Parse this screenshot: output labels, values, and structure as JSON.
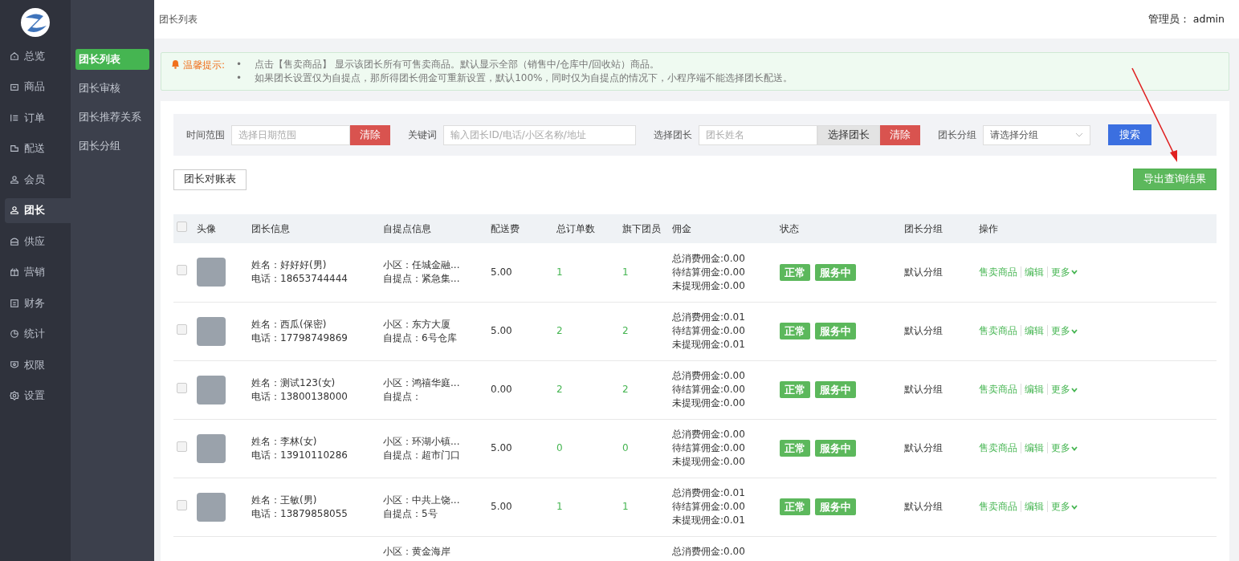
{
  "nav": [
    {
      "label": "总览",
      "selected": false
    },
    {
      "label": "商品",
      "selected": false
    },
    {
      "label": "订单",
      "selected": false
    },
    {
      "label": "配送",
      "selected": false
    },
    {
      "label": "会员",
      "selected": false
    },
    {
      "label": "团长",
      "selected": true
    },
    {
      "label": "供应",
      "selected": false
    },
    {
      "label": "营销",
      "selected": false
    },
    {
      "label": "财务",
      "selected": false
    },
    {
      "label": "统计",
      "selected": false
    },
    {
      "label": "权限",
      "selected": false
    },
    {
      "label": "设置",
      "selected": false
    }
  ],
  "subnav": [
    {
      "label": "团长列表",
      "selected": true
    },
    {
      "label": "团长审核",
      "selected": false
    },
    {
      "label": "团长推荐关系",
      "selected": false
    },
    {
      "label": "团长分组",
      "selected": false
    }
  ],
  "header": {
    "breadcrumb": "团长列表",
    "admin": "管理员： admin"
  },
  "notice": {
    "title": "温馨提示:",
    "items": [
      {
        "marker": "•",
        "text": "点击【售卖商品】 显示该团长所有可售卖商品。默认显示全部（销售中/仓库中/回收站）商品。"
      },
      {
        "marker": "•",
        "text": "如果团长设置仅为自提点，那所得团长佣金可重新设置，默认100%，同时仅为自提点的情况下，小程序端不能选择团长配送。"
      }
    ]
  },
  "filters": [
    {
      "kind": "input",
      "label": "时间范围",
      "placeholder": "选择日期范围",
      "buttons": [
        {
          "kind": "clear",
          "label": "清除"
        }
      ]
    },
    {
      "kind": "input",
      "label": "关键词",
      "placeholder": "输入团长ID/电话/小区名称/地址"
    },
    {
      "kind": "input",
      "label": "选择团长",
      "placeholder": "团长姓名",
      "buttons": [
        {
          "kind": "picker",
          "label": "选择团长"
        },
        {
          "kind": "clear",
          "label": "清除"
        }
      ]
    },
    {
      "kind": "select",
      "label": "团长分组",
      "placeholder": "请选择分组"
    }
  ],
  "search_button": "搜索",
  "statement_button": "团长对账表",
  "export_button": "导出查询结果",
  "table": {
    "select_all": {
      "checked": false
    },
    "columns": [
      "头像",
      "团长信息",
      "自提点信息",
      "配送费",
      "总订单数",
      "旗下团员",
      "佣金",
      "状态",
      "团长分组",
      "操作"
    ],
    "rows": [
      {
        "kind": "full",
        "checked": false,
        "name": "姓名：好好好(男)",
        "phone": "电话：18653744444",
        "community": "小区：任城金融...",
        "pickup": "自提点：紧急集...",
        "fee": "5.00",
        "orders": "1",
        "members": "1",
        "commissions": [
          "总消费佣金:0.00",
          "待结算佣金:0.00",
          "未提现佣金:0.00"
        ],
        "tags": [
          "正常",
          "服务中"
        ],
        "group": "默认分组",
        "actions": [
          "售卖商品",
          "编辑",
          "更多"
        ]
      },
      {
        "kind": "full",
        "checked": false,
        "name": "姓名：西瓜(保密)",
        "phone": "电话：17798749869",
        "community": "小区：东方大厦",
        "pickup": "自提点：6号仓库",
        "fee": "5.00",
        "orders": "2",
        "members": "2",
        "commissions": [
          "总消费佣金:0.01",
          "待结算佣金:0.00",
          "未提现佣金:0.01"
        ],
        "tags": [
          "正常",
          "服务中"
        ],
        "group": "默认分组",
        "actions": [
          "售卖商品",
          "编辑",
          "更多"
        ]
      },
      {
        "kind": "full",
        "checked": false,
        "name": "姓名：测试123(女)",
        "phone": "电话：13800138000",
        "community": "小区：鸿禧华庭...",
        "pickup": "自提点：",
        "fee": "0.00",
        "orders": "2",
        "members": "2",
        "commissions": [
          "总消费佣金:0.00",
          "待结算佣金:0.00",
          "未提现佣金:0.00"
        ],
        "tags": [
          "正常",
          "服务中"
        ],
        "group": "默认分组",
        "actions": [
          "售卖商品",
          "编辑",
          "更多"
        ]
      },
      {
        "kind": "full",
        "checked": false,
        "name": "姓名：李林(女)",
        "phone": "电话：13910110286",
        "community": "小区：环湖小镇...",
        "pickup": "自提点：超市门口",
        "fee": "5.00",
        "orders": "0",
        "members": "0",
        "commissions": [
          "总消费佣金:0.00",
          "待结算佣金:0.00",
          "未提现佣金:0.00"
        ],
        "tags": [
          "正常",
          "服务中"
        ],
        "group": "默认分组",
        "actions": [
          "售卖商品",
          "编辑",
          "更多"
        ]
      },
      {
        "kind": "full",
        "checked": false,
        "name": "姓名：王敏(男)",
        "phone": "电话：13879858055",
        "community": "小区：中共上饶...",
        "pickup": "自提点：5号",
        "fee": "5.00",
        "orders": "1",
        "members": "1",
        "commissions": [
          "总消费佣金:0.01",
          "待结算佣金:0.00",
          "未提现佣金:0.01"
        ],
        "tags": [
          "正常",
          "服务中"
        ],
        "group": "默认分组",
        "actions": [
          "售卖商品",
          "编辑",
          "更多"
        ]
      },
      {
        "kind": "partial",
        "community": "小区：黄金海岸",
        "commissions": [
          "总消费佣金:0.00"
        ]
      }
    ]
  }
}
